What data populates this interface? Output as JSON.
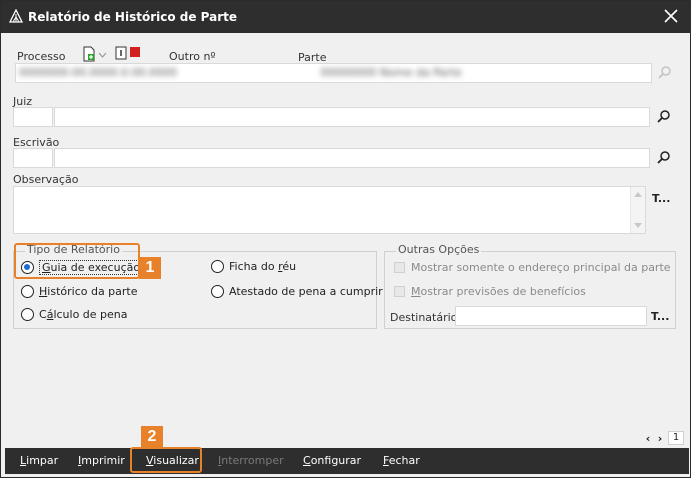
{
  "window": {
    "title": "Relatório de Histórico de Parte"
  },
  "labels": {
    "processo": "Processo",
    "outro": "Outro nº",
    "parte": "Parte",
    "juiz": "Juiz",
    "escrivao": "Escrivão",
    "observacao": "Observação"
  },
  "fields": {
    "processo_value": "0000000-00.0000.0.00.0000",
    "parte_value": "00000000   Nome da Parte"
  },
  "observacao_side_btn": "T...",
  "tipo_relatorio": {
    "legend": "Tipo de Relatório",
    "options": [
      {
        "pre": "",
        "accel": "G",
        "post": "uia de execução"
      },
      {
        "pre": "",
        "accel": "H",
        "post": "istórico da parte"
      },
      {
        "pre": "C",
        "accel": "á",
        "post": "lculo de pena"
      },
      {
        "pre": "Ficha do ",
        "accel": "r",
        "post": "éu"
      },
      {
        "pre": "Atestado de pena a cumprir",
        "accel": "",
        "post": ""
      }
    ],
    "selected": 0
  },
  "outras_opcoes": {
    "legend": "Outras Opções",
    "checks": [
      {
        "label": "Mostrar somente o endereço principal da parte",
        "checked": false
      },
      {
        "pre": "",
        "accel": "M",
        "post": "ostrar previsões de benefícios",
        "checked": false
      }
    ],
    "destinatario_label": "Destinatário",
    "destinatario_btn": "T..."
  },
  "annotations": {
    "badge1": "1",
    "badge2": "2"
  },
  "pager": {
    "page": "1"
  },
  "toolbar": [
    {
      "accel": "L",
      "post": "impar",
      "disabled": false
    },
    {
      "accel": "I",
      "post": "mprimir",
      "disabled": false
    },
    {
      "accel": "V",
      "post": "isualizar",
      "disabled": false
    },
    {
      "accel": "I",
      "post": "nterromper",
      "disabled": true
    },
    {
      "accel": "C",
      "post": "onfigurar",
      "disabled": false
    },
    {
      "accel": "F",
      "post": "echar",
      "disabled": false
    }
  ],
  "colors": {
    "accent": "#e8822a",
    "titlebar": "#2e2e2e",
    "radio_on": "#1e6ad8"
  }
}
